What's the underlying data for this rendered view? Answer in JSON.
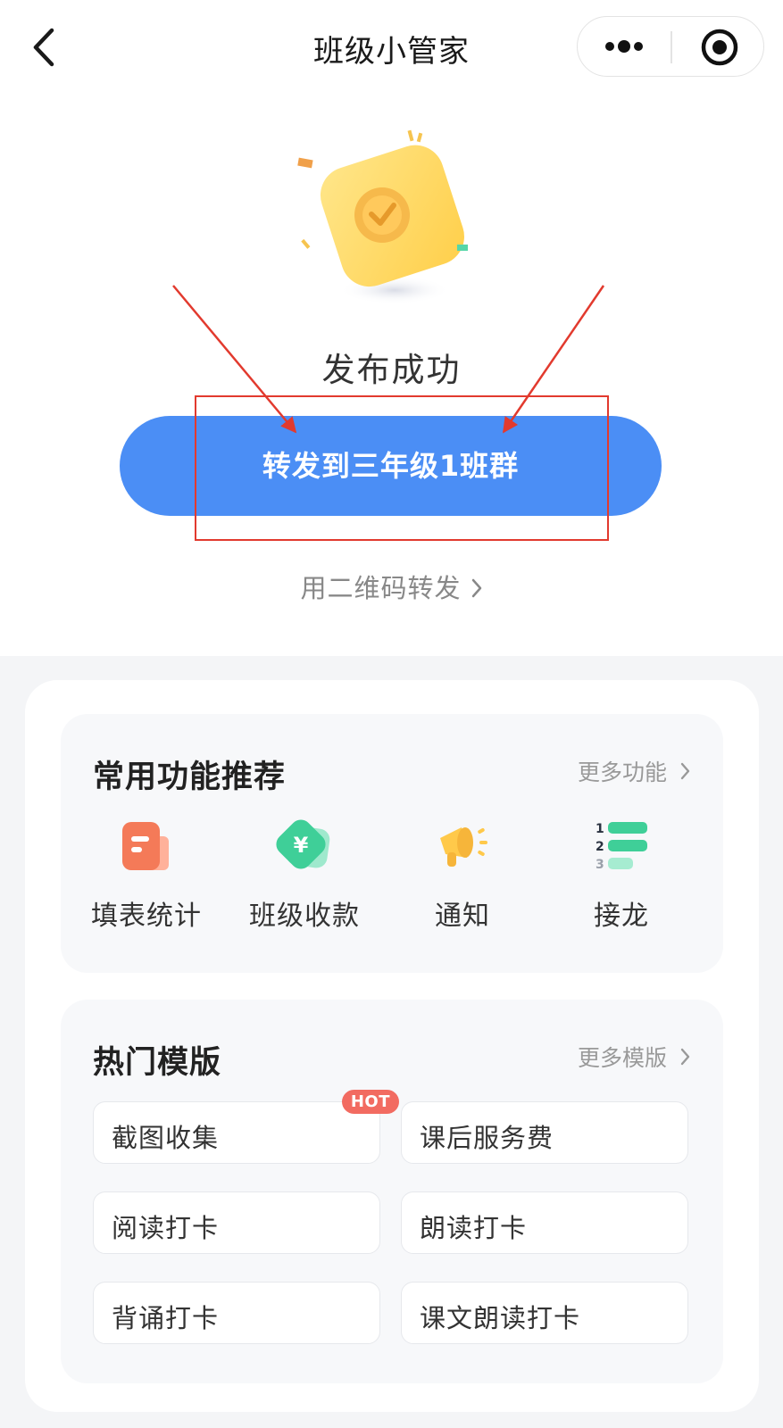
{
  "header": {
    "title": "班级小管家"
  },
  "result": {
    "status_text": "发布成功",
    "forward_button": "转发到三年级1班群",
    "qr_link": "用二维码转发"
  },
  "features": {
    "title": "常用功能推荐",
    "more": "更多功能",
    "items": [
      {
        "label": "填表统计",
        "icon": "form-icon"
      },
      {
        "label": "班级收款",
        "icon": "payment-icon"
      },
      {
        "label": "通知",
        "icon": "megaphone-icon"
      },
      {
        "label": "接龙",
        "icon": "numbered-list-icon"
      }
    ]
  },
  "templates": {
    "title": "热门模版",
    "more": "更多模版",
    "items": [
      {
        "label": "截图收集",
        "badge": "HOT"
      },
      {
        "label": "课后服务费"
      },
      {
        "label": "阅读打卡"
      },
      {
        "label": "朗读打卡"
      },
      {
        "label": "背诵打卡"
      },
      {
        "label": "课文朗读打卡"
      }
    ]
  },
  "colors": {
    "primary": "#4b8ef5",
    "annotation": "#e23a2e",
    "hot_badge": "#f26b61"
  }
}
